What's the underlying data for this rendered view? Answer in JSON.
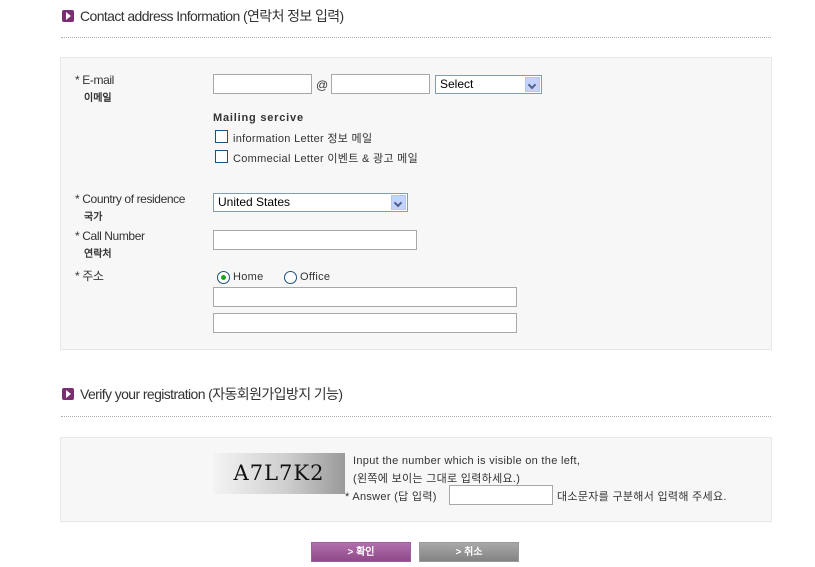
{
  "section1": {
    "title": "Contact address Information (연락처 정보 입력)"
  },
  "email": {
    "label": "E-mail",
    "sub": "이메일",
    "at": "@",
    "domain_select": "Select"
  },
  "mailing": {
    "title": "Mailing sercive",
    "option1": "information Letter 정보 메일",
    "option2": "Commecial Letter 이벤트 & 광고 메일"
  },
  "country": {
    "label": "Country of residence",
    "sub": "국가",
    "value": "United States"
  },
  "call": {
    "label": "Call Number",
    "sub": "연락처"
  },
  "address": {
    "label": "주소",
    "home": "Home",
    "office": "Office",
    "selected": "Home"
  },
  "section2": {
    "title": "Verify your registration (자동회원가입방지 기능)"
  },
  "verify": {
    "captcha": "A7L7K2",
    "instr1": "Input the number which is visible on the left,",
    "instr2": "(왼쪽에 보이는 그대로 입력하세요.)",
    "answer_label": "* Answer (답 입력)",
    "case_note": "대소문자를 구분해서 입력해 주세요."
  },
  "buttons": {
    "confirm": "> 확인",
    "cancel": "> 취소"
  },
  "colors": {
    "accent": "#8f4889",
    "panel": "#f7f7f7",
    "radio_dot": "#21a121"
  },
  "icons": {
    "section": "arrow-right-icon",
    "select_arrow": "chevron-down-icon"
  }
}
